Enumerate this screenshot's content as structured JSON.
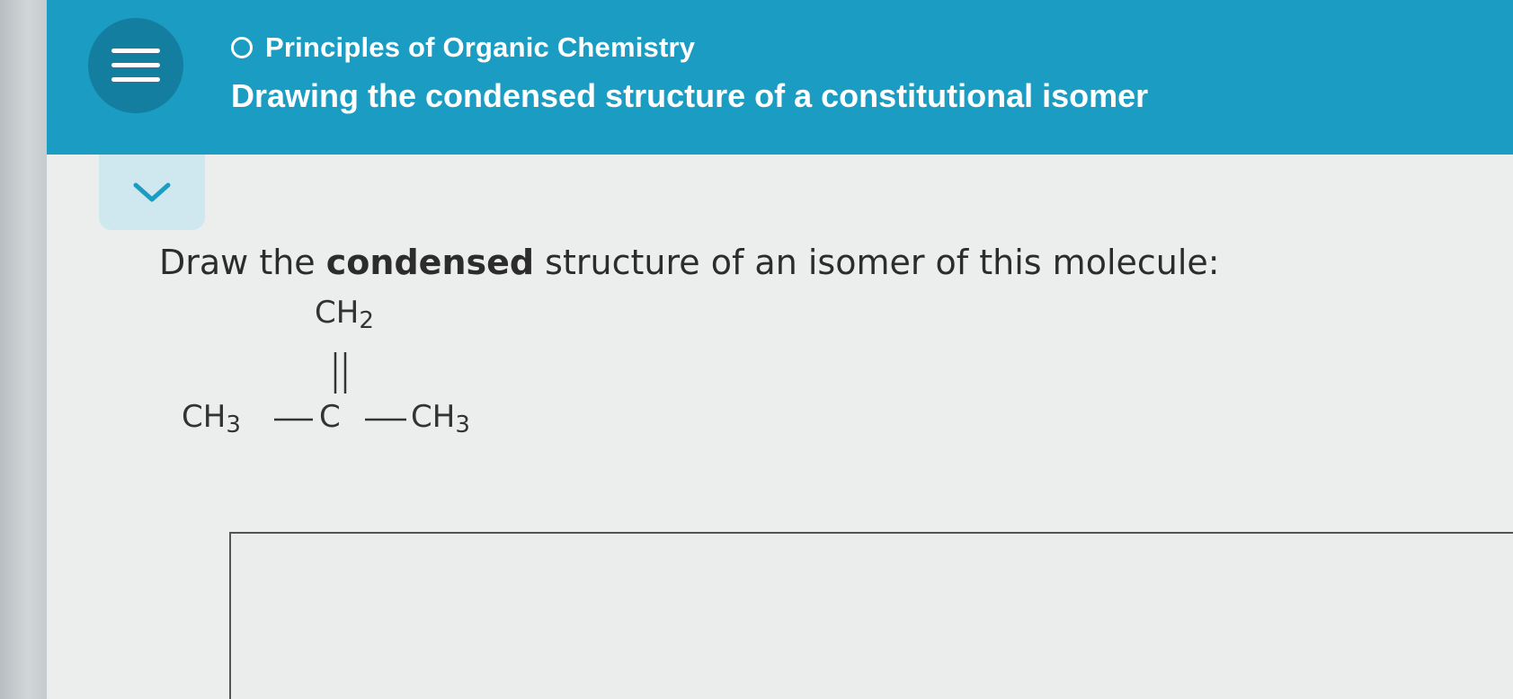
{
  "header": {
    "course_name": "Principles of Organic Chemistry",
    "topic_title": "Drawing the condensed structure of a constitutional isomer"
  },
  "question": {
    "prompt_before": "Draw the ",
    "prompt_bold": "condensed",
    "prompt_after": " structure of an isomer of this molecule:"
  },
  "molecule": {
    "top_group": "CH",
    "top_group_sub": "2",
    "left_group": "CH",
    "left_group_sub": "3",
    "center_atom": "C",
    "right_group": "CH",
    "right_group_sub": "3"
  },
  "icons": {
    "menu": "hamburger-menu-icon",
    "status": "empty-circle-icon",
    "collapse": "chevron-down-icon"
  },
  "colors": {
    "header_bg": "#1b9cc2",
    "menu_bg": "#137e9f",
    "collapse_tab_bg": "#cfe7ef",
    "collapse_chevron": "#1b9cc2"
  }
}
